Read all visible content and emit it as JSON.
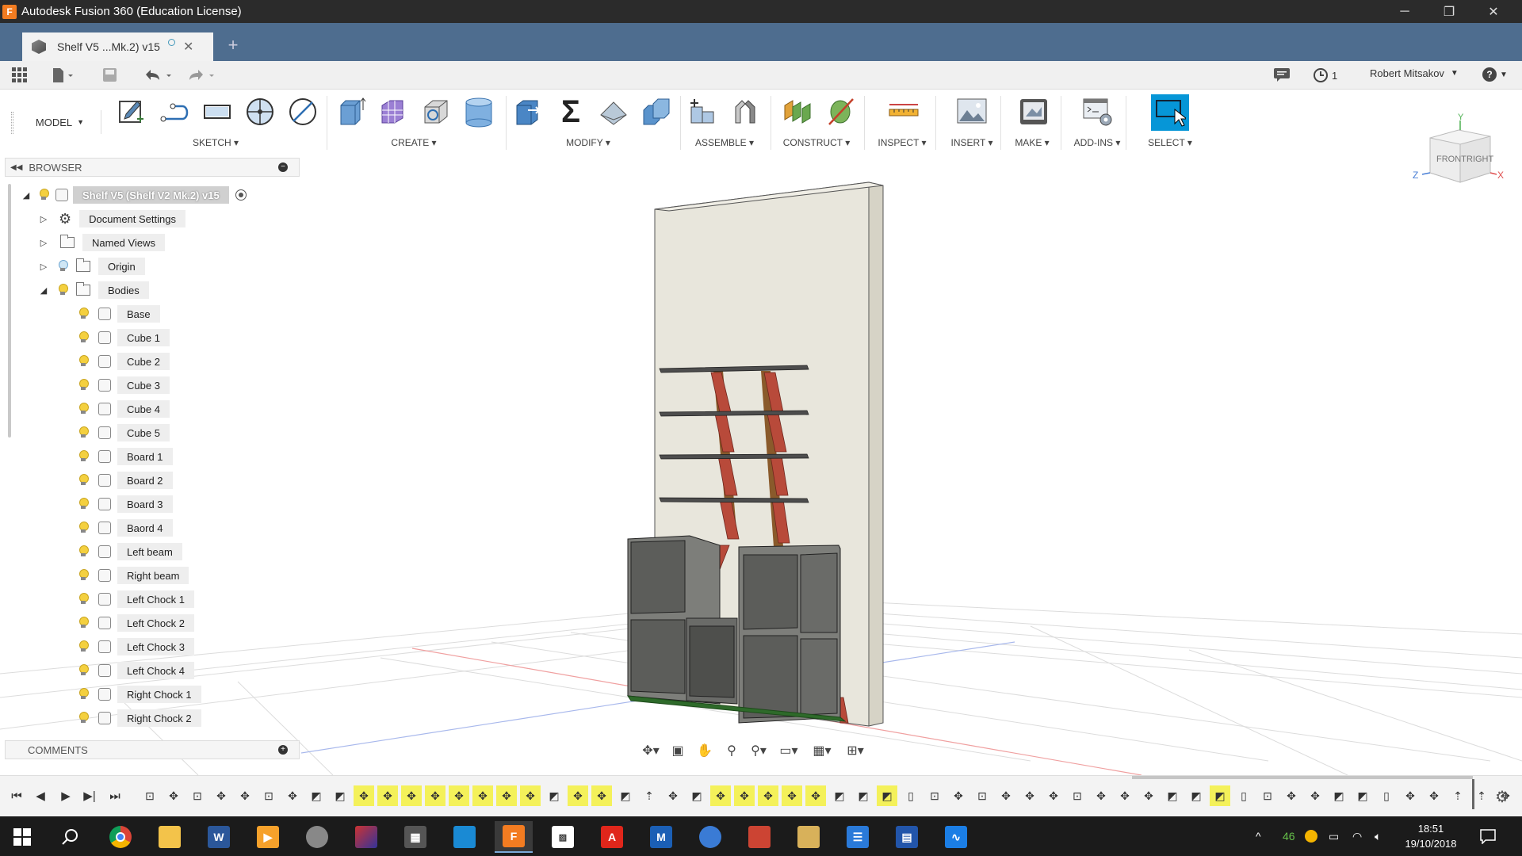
{
  "window": {
    "title": "Autodesk Fusion 360 (Education License)",
    "minimize": "─",
    "restore": "❐",
    "close": "✕"
  },
  "tab": {
    "name": "Shelf V5 ...Mk.2) v15",
    "close": "✕",
    "new": "+"
  },
  "qat": {
    "updates_count": "1",
    "user_name": "Robert Mitsakov",
    "help": "?"
  },
  "ribbon": {
    "workspace": "MODEL",
    "groups": [
      {
        "label": "SKETCH"
      },
      {
        "label": "CREATE"
      },
      {
        "label": "MODIFY"
      },
      {
        "label": "ASSEMBLE"
      },
      {
        "label": "CONSTRUCT"
      },
      {
        "label": "INSPECT"
      },
      {
        "label": "INSERT"
      },
      {
        "label": "MAKE"
      },
      {
        "label": "ADD-INS"
      },
      {
        "label": "SELECT"
      }
    ],
    "modify_sum_glyph": "Σ"
  },
  "browser": {
    "title": "BROWSER",
    "root": "Shelf V5 (Shelf V2 Mk.2) v15",
    "folders": [
      "Document Settings",
      "Named Views",
      "Origin",
      "Bodies"
    ],
    "bodies": [
      "Base",
      "Cube 1",
      "Cube 2",
      "Cube 3",
      "Cube 4",
      "Cube 5",
      "Board 1",
      "Board 2",
      "Board 3",
      "Baord 4",
      "Left beam",
      "Right beam",
      "Left Chock 1",
      "Left Chock 2",
      "Left Chock 3",
      "Left Chock 4",
      "Right Chock 1",
      "Right Chock 2"
    ]
  },
  "comments": {
    "title": "COMMENTS"
  },
  "viewcube": {
    "front": "FRONT",
    "right": "RIGHT",
    "axis_x": "X",
    "axis_y": "Y",
    "axis_z": "Z"
  },
  "taskbar": {
    "time": "18:51",
    "date": "19/10/2018",
    "tray_number": "46"
  },
  "colors": {
    "accent": "#0696d7",
    "tabbar": "#4e6d8f",
    "timeline_highlight": "#f4f15a",
    "wall": "#e8e6dc",
    "cube_body": "#7d7e7a",
    "strut": "#b84a3a"
  }
}
